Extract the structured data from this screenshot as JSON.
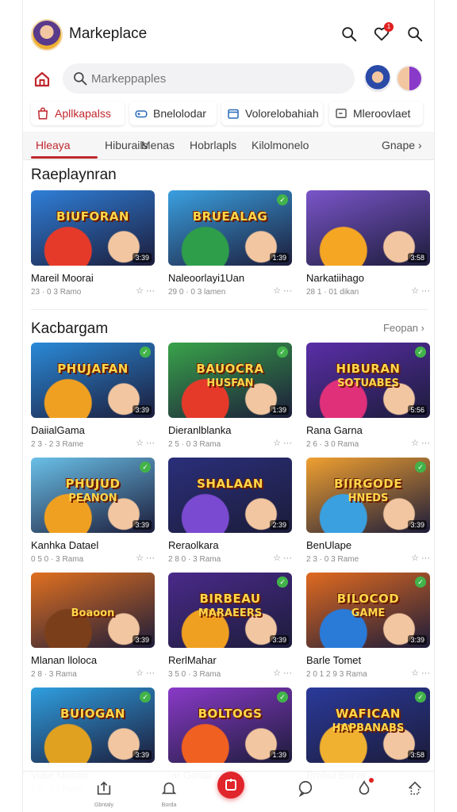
{
  "header": {
    "title": "Markeplace",
    "notification_count": "1"
  },
  "search": {
    "placeholder": "Markeppaples",
    "value": ""
  },
  "chips": [
    {
      "label": "Apllkapalss",
      "icon": "bag-icon",
      "active": true
    },
    {
      "label": "Bnelolodar",
      "icon": "gamepad-icon",
      "active": false
    },
    {
      "label": "Volorelobahiah",
      "icon": "box-icon",
      "active": false
    },
    {
      "label": "Mleroovlaet",
      "icon": "window-icon",
      "active": false
    }
  ],
  "tabs": [
    {
      "label": "Hleaya",
      "active": true
    },
    {
      "label": "Hiburails",
      "active": false
    },
    {
      "label": "Menas",
      "active": false
    },
    {
      "label": "Hobrlapls",
      "active": false
    },
    {
      "label": "Kilolmonelo",
      "active": false
    }
  ],
  "tabs_more": "Gnape",
  "sections": [
    {
      "title": "Raeplaynran",
      "see_all": "",
      "cards": [
        {
          "thumb_title": "BIUFORAN",
          "thumb_sub": "",
          "duration": "3:39",
          "verified": false,
          "title": "Mareil Moorai",
          "meta": "23 · 0 3 Ramo",
          "bg": "#2f7fd8",
          "accent": "#e53a2a"
        },
        {
          "thumb_title": "BRUEALAG",
          "thumb_sub": "",
          "duration": "1:39",
          "verified": true,
          "title": "Naleoorlayi1Uan",
          "meta": "29 0 · 0 3 lamen",
          "bg": "#3aa0e0",
          "accent": "#2e9e4a"
        },
        {
          "thumb_title": "",
          "thumb_sub": "",
          "duration": "3:58",
          "verified": false,
          "title": "Narkatiihago",
          "meta": "28 1 · 01 dikan",
          "bg": "#7a55c9",
          "accent": "#f5a623"
        }
      ]
    },
    {
      "title": "Kacbargam",
      "see_all": "Feopan",
      "cards": [
        {
          "thumb_title": "PHUJAFAN",
          "thumb_sub": "",
          "duration": "3:39",
          "verified": true,
          "title": "DaiialGama",
          "meta": "2 3 · 2 3 Rame",
          "bg": "#2a8ad8",
          "accent": "#f0a020"
        },
        {
          "thumb_title": "BAUOCRA",
          "thumb_sub": "HUSFAN",
          "duration": "1:39",
          "verified": true,
          "title": "Dieranlblanka",
          "meta": "2 5 · 0 3 Rama",
          "bg": "#39a34a",
          "accent": "#e53a2a"
        },
        {
          "thumb_title": "HIBURAN",
          "thumb_sub": "SOTUABES",
          "duration": "5:56",
          "verified": true,
          "title": "Rana Garna",
          "meta": "2 6 · 3 0 Rama",
          "bg": "#5a2ea8",
          "accent": "#e0307a"
        },
        {
          "thumb_title": "PHUJUD",
          "thumb_sub": "PEANON",
          "duration": "3:39",
          "verified": true,
          "title": "Kanhka Datael",
          "meta": "0 5 0 · 3 Rama",
          "bg": "#6ac0e8",
          "accent": "#f0a020"
        },
        {
          "thumb_title": "SHALAAN",
          "thumb_sub": "",
          "duration": "2:39",
          "verified": false,
          "title": "Reraolkara",
          "meta": "2 8 0 · 3 Rama",
          "bg": "#2a2f7a",
          "accent": "#7a4ad0"
        },
        {
          "thumb_title": "BIIRGODE",
          "thumb_sub": "HNEDS",
          "duration": "3:39",
          "verified": true,
          "title": "BenUlape",
          "meta": "2 3 · 0 3 Rame",
          "bg": "#f0a030",
          "accent": "#3aa0e0"
        },
        {
          "thumb_title": "",
          "thumb_sub": "Boaoon",
          "duration": "3:39",
          "verified": false,
          "title": "Mlanan lloloca",
          "meta": "2 8 · 3 Rama",
          "bg": "#e07020",
          "accent": "#7a3e1a"
        },
        {
          "thumb_title": "BIRBEAU",
          "thumb_sub": "MARAEERS",
          "duration": "3:39",
          "verified": true,
          "title": "RerlMahar",
          "meta": "3 5 0 · 3 Rama",
          "bg": "#4a2a8a",
          "accent": "#f0a020"
        },
        {
          "thumb_title": "BILOCOD",
          "thumb_sub": "GAME",
          "duration": "3:39",
          "verified": true,
          "title": "Barle Tomet",
          "meta": "2 0 1 2 9 3 Rama",
          "bg": "#e06a20",
          "accent": "#2a7ad8"
        },
        {
          "thumb_title": "BUIOGAN",
          "thumb_sub": "",
          "duration": "3:39",
          "verified": true,
          "title": "Vake Monen",
          "meta": "2 2 · 0 5 Rame",
          "bg": "#2f9fe0",
          "accent": "#e0a020"
        },
        {
          "thumb_title": "BOLTOGS",
          "thumb_sub": "",
          "duration": "1:39",
          "verified": true,
          "title": "Iar Gonar",
          "meta": "",
          "bg": "#8a3ac8",
          "accent": "#f06020"
        },
        {
          "thumb_title": "WAFICAN",
          "thumb_sub": "HAPBANABS",
          "duration": "3:58",
          "verified": true,
          "title": "Prohul Bonar",
          "meta": "",
          "bg": "#2a3a9a",
          "accent": "#f0b030"
        }
      ]
    }
  ],
  "bottom_nav": [
    {
      "label": "Gbntaly",
      "icon": "upload-icon"
    },
    {
      "label": "Borda",
      "icon": "bell-icon"
    },
    {
      "label": "",
      "icon": "plus-icon"
    },
    {
      "label": "",
      "icon": "chat-icon"
    },
    {
      "label": "",
      "icon": "flame-icon"
    },
    {
      "label": "",
      "icon": "home-up-icon"
    }
  ],
  "colors": {
    "accent": "#c0272d",
    "fab": "#e0252b",
    "verified": "#42b34a"
  }
}
